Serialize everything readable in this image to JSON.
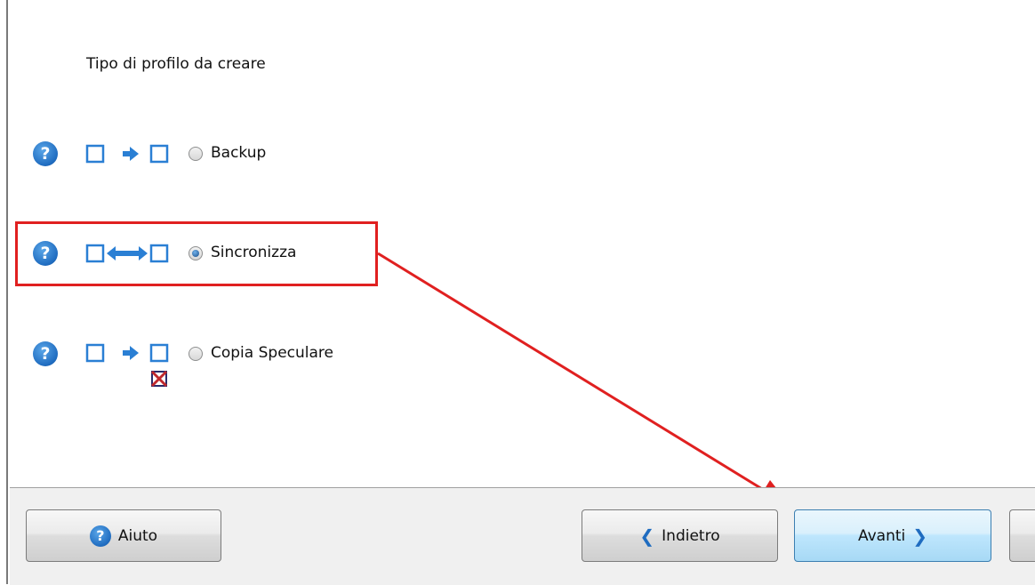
{
  "heading": "Tipo di profilo da creare",
  "options": [
    {
      "label": "Backup",
      "checked": false,
      "help_icon": "question-help-icon",
      "diagram_icon": "one-way-arrow-icon"
    },
    {
      "label": "Sincronizza",
      "checked": true,
      "help_icon": "question-help-icon",
      "diagram_icon": "two-way-arrow-icon"
    },
    {
      "label": "Copia Speculare",
      "checked": false,
      "help_icon": "question-help-icon",
      "diagram_icon": "mirror-arrow-icon"
    }
  ],
  "help_glyph": "?",
  "buttons": {
    "help": {
      "label": "Aiuto",
      "icon": "question-help-icon"
    },
    "back": {
      "label": "Indietro",
      "icon": "chevron-left-icon"
    },
    "next": {
      "label": "Avanti",
      "icon": "chevron-right-icon"
    }
  },
  "colors": {
    "accent_blue": "#1f6cc0",
    "annotation_red": "#e02020",
    "footer_bg": "#f0f0f0"
  }
}
